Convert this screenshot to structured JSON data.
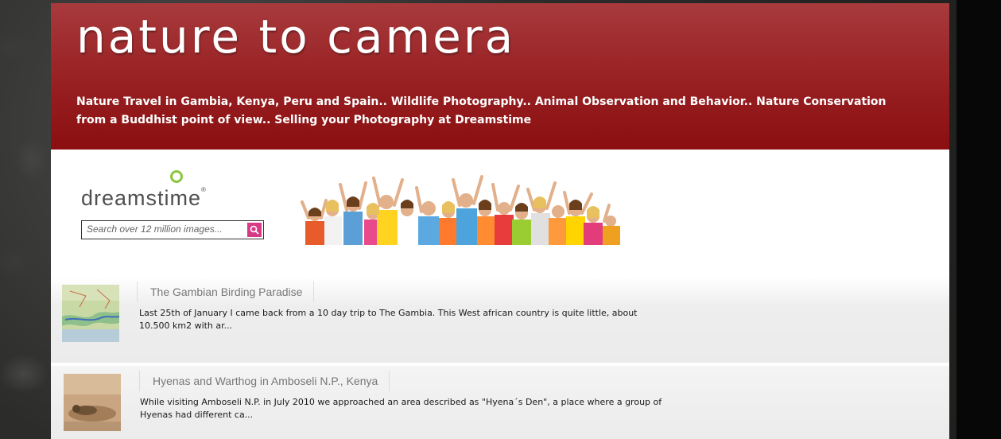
{
  "site": {
    "title": "nature to camera",
    "tagline": "Nature Travel in Gambia, Kenya, Peru and Spain.. Wildlife Photography.. Animal Observation and Behavior.. Nature Conservation from a Buddhist point of view.. Selling your Photography at Dreamstime"
  },
  "ad": {
    "logo_text": "dreamstime",
    "logo_reg": "®",
    "search_placeholder": "Search over 12 million images...",
    "search_icon": "search-icon"
  },
  "posts": [
    {
      "title": "The Gambian Birding Paradise",
      "excerpt": "Last 25th of January I came back from a 10 day trip to The Gambia. This West african country is quite little, about 10.500 km2 with ar...",
      "thumb_icon": "map-thumbnail"
    },
    {
      "title": "Hyenas and Warthog in Amboseli N.P., Kenya",
      "excerpt": "While visiting Amboseli N.P. in July 2010 we approached an area described as \"Hyena´s Den\", a place where a group of Hyenas had different ca...",
      "thumb_icon": "hyena-thumbnail"
    }
  ],
  "colors": {
    "header_top": "#a83a3d",
    "header_bottom": "#8b0e10",
    "search_button": "#d63a86",
    "logo_green": "#8cc63f"
  }
}
